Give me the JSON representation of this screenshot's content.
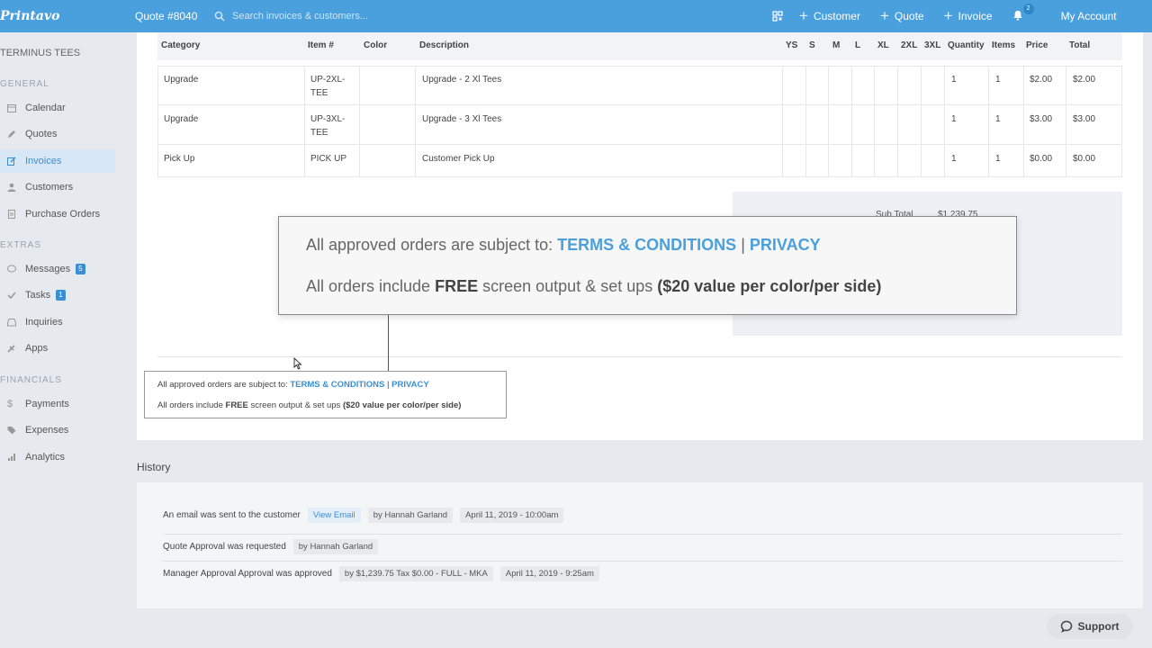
{
  "topbar": {
    "logo": "Printavo",
    "quote_number": "Quote #8040",
    "search_placeholder": "Search invoices & customers...",
    "actions": [
      "Customer",
      "Quote",
      "Invoice"
    ],
    "notification_count": "2",
    "account": "My Account",
    "icons": [
      "search-icon",
      "qr-code-icon",
      "plus-icon",
      "bell-icon"
    ]
  },
  "sidebar": {
    "company": "TERMINUS TEES",
    "general_label": "GENERAL",
    "general": [
      {
        "label": "Calendar",
        "icon": "calendar-icon"
      },
      {
        "label": "Quotes",
        "icon": "pencil-icon"
      },
      {
        "label": "Invoices",
        "icon": "edit-icon",
        "active": true
      },
      {
        "label": "Customers",
        "icon": "user-icon"
      },
      {
        "label": "Purchase Orders",
        "icon": "document-icon"
      }
    ],
    "extras_label": "EXTRAS",
    "extras": [
      {
        "label": "Messages",
        "icon": "chat-icon",
        "badge": "5"
      },
      {
        "label": "Tasks",
        "icon": "check-icon",
        "badge": "1"
      },
      {
        "label": "Inquiries",
        "icon": "inbox-icon"
      },
      {
        "label": "Apps",
        "icon": "puzzle-icon"
      }
    ],
    "financials_label": "FINANCIALS",
    "financials": [
      {
        "label": "Payments",
        "icon": "dollar-icon"
      },
      {
        "label": "Expenses",
        "icon": "tag-icon"
      },
      {
        "label": "Analytics",
        "icon": "bar-chart-icon"
      }
    ]
  },
  "table": {
    "headers": [
      "Category",
      "Item #",
      "Color",
      "Description",
      "YS",
      "S",
      "M",
      "L",
      "XL",
      "2XL",
      "3XL",
      "Quantity",
      "Items",
      "Price",
      "Total"
    ],
    "rows": [
      {
        "category": "Upgrade",
        "item1": "UP-2XL-",
        "item2": "TEE",
        "color": "",
        "description": "Upgrade - 2 Xl Tees",
        "quantity": "1",
        "items": "1",
        "price": "$2.00",
        "total": "$2.00"
      },
      {
        "category": "Upgrade",
        "item1": "UP-3XL-",
        "item2": "TEE",
        "color": "",
        "description": "Upgrade - 3 Xl Tees",
        "quantity": "1",
        "items": "1",
        "price": "$3.00",
        "total": "$3.00"
      },
      {
        "category": "Pick Up",
        "item1": "PICK UP",
        "item2": "",
        "color": "",
        "description": "Customer Pick Up",
        "quantity": "1",
        "items": "1",
        "price": "$0.00",
        "total": "$0.00"
      }
    ]
  },
  "summary": {
    "subtotal_label": "Sub Total",
    "subtotal_value": "$1,239.75"
  },
  "terms": {
    "prefix": "All approved orders are subject to:",
    "terms_link": "TERMS & CONDITIONS",
    "separator": "|",
    "privacy_link": "PRIVACY",
    "free_prefix": "All orders include",
    "free_word": "FREE",
    "free_mid": "screen output & set ups",
    "free_value": "($20 value per color/per side)"
  },
  "history": {
    "title": "History",
    "entries": [
      {
        "text": "An email was sent to the customer",
        "link": "View Email",
        "by": "by Hannah Garland",
        "date": "April 11, 2019 - 10:00am"
      },
      {
        "text": "Quote Approval was requested",
        "by": "by Hannah Garland"
      },
      {
        "text": "Manager Approval Approval was approved",
        "by": "by $1,239.75 Tax $0.00 - FULL - MKA",
        "date": "April 11, 2019 - 9:25am"
      }
    ]
  },
  "support": {
    "label": "Support"
  },
  "colors": {
    "brand": "#4a9fdd",
    "link": "#3a8fd3"
  }
}
